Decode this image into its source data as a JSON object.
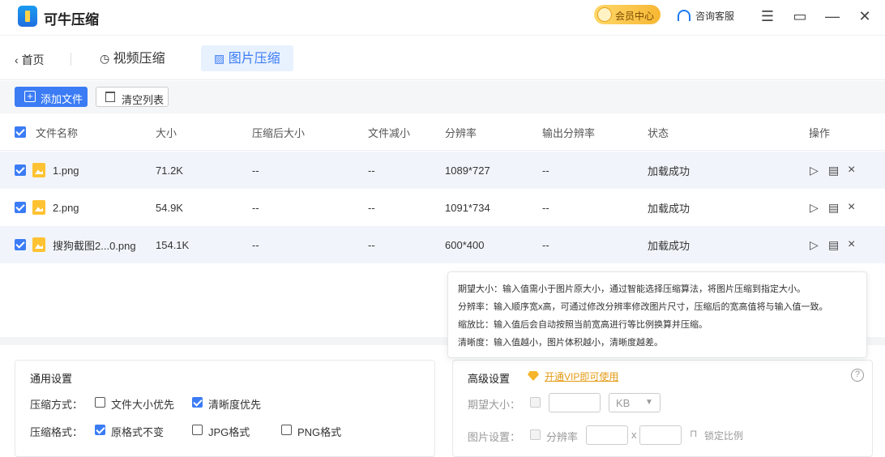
{
  "app": {
    "title": "可牛压缩"
  },
  "titlebar": {
    "vip_label": "会员中心",
    "service_label": "咨询客服"
  },
  "nav": {
    "back_label": "首页",
    "tabs": [
      {
        "label": "视频压缩"
      },
      {
        "label": "图片压缩"
      }
    ]
  },
  "toolbar": {
    "add_label": "添加文件",
    "clear_label": "清空列表"
  },
  "table": {
    "headers": [
      "文件名称",
      "大小",
      "压缩后大小",
      "文件减小",
      "分辨率",
      "输出分辨率",
      "状态",
      "操作"
    ],
    "rows": [
      {
        "name": "1.png",
        "size": "71.2K",
        "compressed": "--",
        "reduced": "--",
        "resolution": "1089*727",
        "out_res": "--",
        "status": "加载成功"
      },
      {
        "name": "2.png",
        "size": "54.9K",
        "compressed": "--",
        "reduced": "--",
        "resolution": "1091*734",
        "out_res": "--",
        "status": "加载成功"
      },
      {
        "name": "搜狗截图2...0.png",
        "size": "154.1K",
        "compressed": "--",
        "reduced": "--",
        "resolution": "600*400",
        "out_res": "--",
        "status": "加载成功"
      }
    ]
  },
  "tooltip": {
    "lines": [
      "期望大小：输入值需小于图片原大小，通过智能选择压缩算法，将图片压缩到指定大小。",
      "分辨率：输入顺序宽x高，可通过修改分辨率修改图片尺寸，压缩后的宽高值将与输入值一致。",
      "缩放比：输入值后会自动按照当前宽高进行等比例换算并压缩。",
      "清晰度：输入值越小，图片体积越小，清晰度越差。"
    ]
  },
  "general": {
    "title": "通用设置",
    "mode_label": "压缩方式：",
    "mode_opt1": "文件大小优先",
    "mode_opt2": "清晰度优先",
    "format_label": "压缩格式：",
    "format_opt1": "原格式不变",
    "format_opt2": "JPG格式",
    "format_opt3": "PNG格式"
  },
  "advanced": {
    "title": "高级设置",
    "vip_link": "开通VIP即可使用",
    "help_icon": "?",
    "expected_label": "期望大小：",
    "unit": "KB",
    "image_label": "图片设置：",
    "res_label": "分辨率",
    "x_sep": "x",
    "lock_label": "锁定比例"
  },
  "colors": {
    "accent": "#3b7cf5",
    "vip": "#f5b52c",
    "row_alt": "#f1f5fb"
  }
}
